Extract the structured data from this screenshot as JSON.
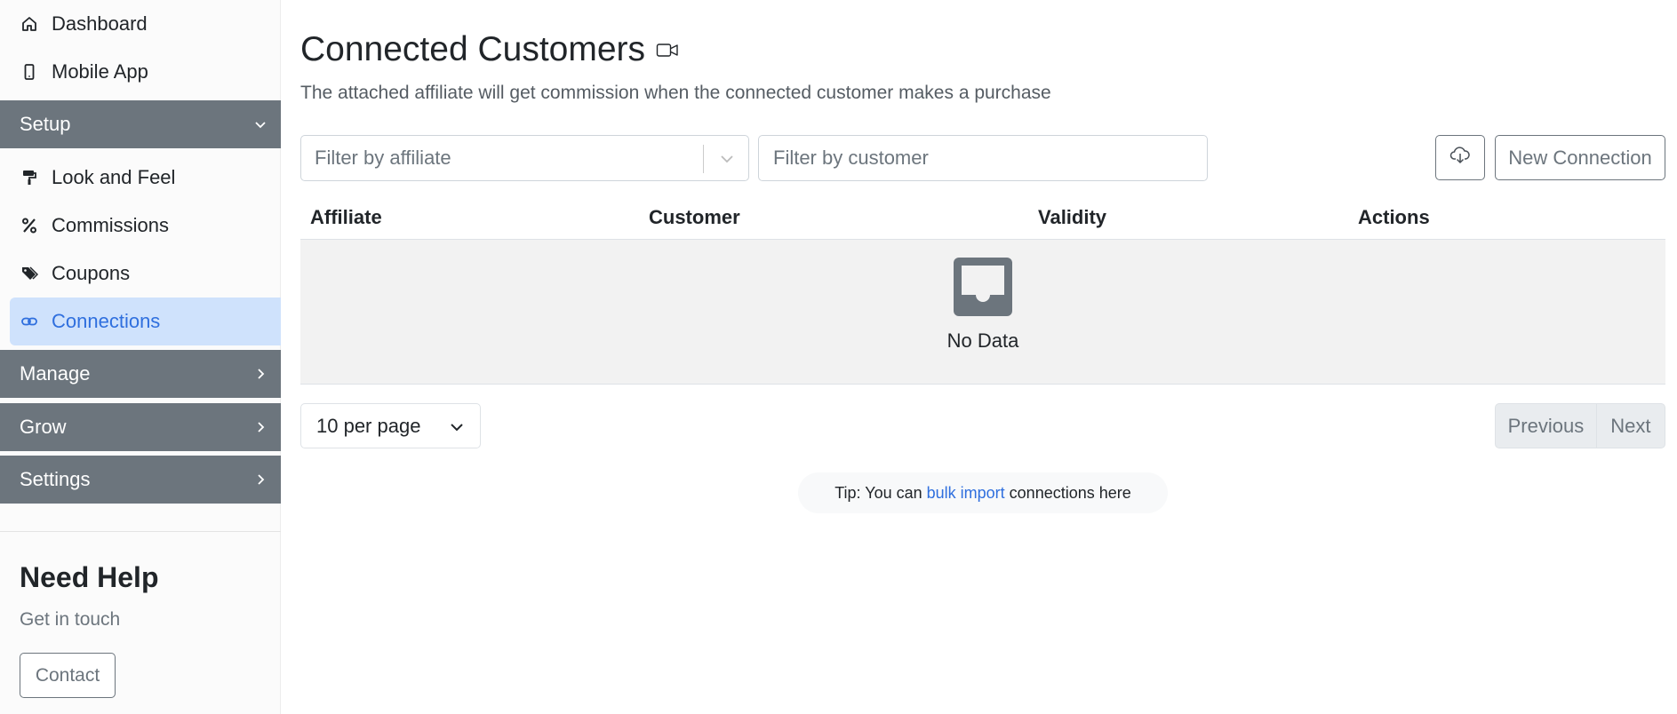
{
  "sidebar": {
    "top_items": [
      {
        "label": "Dashboard",
        "icon": "home-icon"
      },
      {
        "label": "Mobile App",
        "icon": "phone-icon"
      }
    ],
    "setup_section": {
      "label": "Setup",
      "expanded": true
    },
    "setup_items": [
      {
        "label": "Look and Feel",
        "icon": "paint-roller-icon"
      },
      {
        "label": "Commissions",
        "icon": "percent-icon"
      },
      {
        "label": "Coupons",
        "icon": "tags-icon"
      },
      {
        "label": "Connections",
        "icon": "link-icon",
        "active": true
      }
    ],
    "sections": [
      {
        "label": "Manage"
      },
      {
        "label": "Grow"
      },
      {
        "label": "Settings"
      }
    ],
    "help": {
      "title": "Need Help",
      "subtitle": "Get in touch",
      "contact_label": "Contact"
    }
  },
  "main": {
    "title": "Connected Customers",
    "title_icon": "video-camera-icon",
    "subtitle": "The attached affiliate will get commission when the connected customer makes a purchase",
    "filter_affiliate_placeholder": "Filter by affiliate",
    "filter_customer_placeholder": "Filter by customer",
    "download_icon": "cloud-download-icon",
    "new_connection_label": "New Connection",
    "table": {
      "columns": [
        "Affiliate",
        "Customer",
        "Validity",
        "Actions"
      ],
      "rows": [],
      "empty_text": "No Data"
    },
    "per_page": "10 per page",
    "pagination": {
      "previous": "Previous",
      "next": "Next"
    },
    "tip": {
      "prefix": "Tip: You can",
      "link": "bulk import",
      "suffix": "connections here"
    }
  },
  "colors": {
    "section_bg": "#6c757d",
    "active_bg": "#cfe2fc",
    "active_text": "#2f6fde",
    "link": "#2f6fde"
  }
}
